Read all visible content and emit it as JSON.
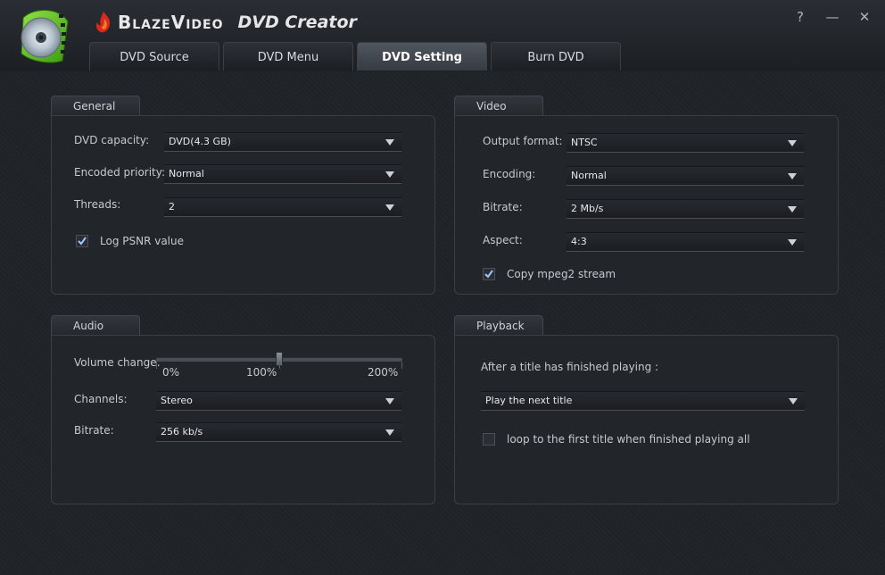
{
  "app": {
    "brand": "BlazeVideo",
    "product": "DVD Creator",
    "window_buttons": {
      "help": "?",
      "minimize": "—",
      "close": "✕"
    }
  },
  "tabs": [
    {
      "label": "DVD Source",
      "active": false
    },
    {
      "label": "DVD Menu",
      "active": false
    },
    {
      "label": "DVD Setting",
      "active": true
    },
    {
      "label": "Burn DVD",
      "active": false
    }
  ],
  "general": {
    "title": "General",
    "dvd_capacity": {
      "label": "DVD capacity:",
      "value": "DVD(4.3 GB)"
    },
    "encoded_priority": {
      "label": "Encoded priority:",
      "value": "Normal"
    },
    "threads": {
      "label": "Threads:",
      "value": "2"
    },
    "log_psnr": {
      "label": "Log PSNR value",
      "checked": true
    }
  },
  "video": {
    "title": "Video",
    "output_format": {
      "label": "Output format:",
      "value": "NTSC"
    },
    "encoding": {
      "label": "Encoding:",
      "value": "Normal"
    },
    "bitrate": {
      "label": "Bitrate:",
      "value": "2 Mb/s"
    },
    "aspect": {
      "label": "Aspect:",
      "value": "4:3"
    },
    "copy_mpeg2": {
      "label": "Copy mpeg2 stream",
      "checked": true
    }
  },
  "audio": {
    "title": "Audio",
    "volume_change": {
      "label": "Volume change:",
      "value_percent": 100,
      "range_percent": [
        0,
        200
      ],
      "tick_labels": [
        "0%",
        "100%",
        "200%"
      ]
    },
    "channels": {
      "label": "Channels:",
      "value": "Stereo"
    },
    "bitrate": {
      "label": "Bitrate:",
      "value": "256 kb/s"
    }
  },
  "playback": {
    "title": "Playback",
    "after_title_label": "After a title has finished playing :",
    "after_title_value": "Play the next title",
    "loop": {
      "label": "loop to the first title when finished playing all",
      "checked": false
    }
  },
  "colors": {
    "background": "#1e2126",
    "panel": "#22252a",
    "disc_green": "#5cc92a"
  }
}
